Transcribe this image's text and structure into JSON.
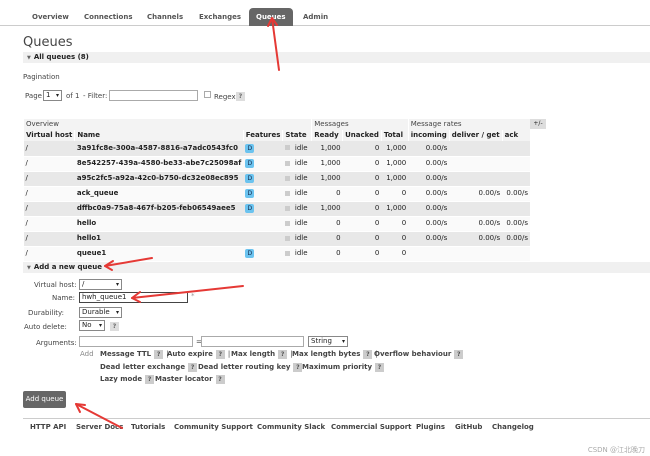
{
  "nav": [
    "Overview",
    "Connections",
    "Channels",
    "Exchanges",
    "Queues",
    "Admin"
  ],
  "page_title": "Queues",
  "all_queues_label": "All queues (8)",
  "pagination": {
    "heading": "Pagination",
    "page_label": "Page",
    "page_value": "1",
    "of_label": "of 1",
    "filter_label": "- Filter:",
    "regex_label": "Regex",
    "help": "?"
  },
  "table": {
    "group_overview": "Overview",
    "group_messages": "Messages",
    "group_rates": "Message rates",
    "plus_minus": "+/-",
    "headers": [
      "Virtual host",
      "Name",
      "Features",
      "State",
      "Ready",
      "Unacked",
      "Total",
      "incoming",
      "deliver / get",
      "ack"
    ],
    "rows": [
      {
        "vhost": "/",
        "name": "3a91fc8e-300a-4587-8816-a7adc0543fc0",
        "feat": "D",
        "state": "idle",
        "ready": "1,000",
        "unacked": "0",
        "total": "1,000",
        "incoming": "0.00/s",
        "deliver": "",
        "ack": ""
      },
      {
        "vhost": "/",
        "name": "8e542257-439a-4580-be33-abe7c25098af",
        "feat": "D",
        "state": "idle",
        "ready": "1,000",
        "unacked": "0",
        "total": "1,000",
        "incoming": "0.00/s",
        "deliver": "",
        "ack": ""
      },
      {
        "vhost": "/",
        "name": "a95c2fc5-a92a-42c0-b750-dc32e08ec895",
        "feat": "D",
        "state": "idle",
        "ready": "1,000",
        "unacked": "0",
        "total": "1,000",
        "incoming": "0.00/s",
        "deliver": "",
        "ack": ""
      },
      {
        "vhost": "/",
        "name": "ack_queue",
        "feat": "D",
        "state": "idle",
        "ready": "0",
        "unacked": "0",
        "total": "0",
        "incoming": "0.00/s",
        "deliver": "0.00/s",
        "ack": "0.00/s"
      },
      {
        "vhost": "/",
        "name": "dffbc0a9-75a8-467f-b205-feb06549aee5",
        "feat": "D",
        "state": "idle",
        "ready": "1,000",
        "unacked": "0",
        "total": "1,000",
        "incoming": "0.00/s",
        "deliver": "",
        "ack": ""
      },
      {
        "vhost": "/",
        "name": "hello",
        "feat": "",
        "state": "idle",
        "ready": "0",
        "unacked": "0",
        "total": "0",
        "incoming": "0.00/s",
        "deliver": "0.00/s",
        "ack": "0.00/s"
      },
      {
        "vhost": "/",
        "name": "hello1",
        "feat": "",
        "state": "idle",
        "ready": "0",
        "unacked": "0",
        "total": "0",
        "incoming": "0.00/s",
        "deliver": "0.00/s",
        "ack": "0.00/s"
      },
      {
        "vhost": "/",
        "name": "queue1",
        "feat": "D",
        "state": "idle",
        "ready": "0",
        "unacked": "0",
        "total": "0",
        "incoming": "",
        "deliver": "",
        "ack": ""
      }
    ]
  },
  "add_section": "Add a new queue",
  "form": {
    "vhost_label": "Virtual host:",
    "vhost_value": "/",
    "name_label": "Name:",
    "name_value": "hwh_queue1",
    "name_star": "*",
    "durability_label": "Durability:",
    "durability_value": "Durable",
    "autodelete_label": "Auto delete:",
    "autodelete_value": "No",
    "help": "?",
    "arguments_label": "Arguments:",
    "equals": "=",
    "type_value": "String",
    "add_label": "Add",
    "arg_links": [
      "Message TTL",
      "Auto expire",
      "Max length",
      "Max length bytes",
      "Overflow behaviour",
      "Dead letter exchange",
      "Dead letter routing key",
      "Maximum priority",
      "Lazy mode",
      "Master locator"
    ],
    "separator": "|",
    "submit": "Add queue"
  },
  "footer": [
    "HTTP API",
    "Server Docs",
    "Tutorials",
    "Community Support",
    "Community Slack",
    "Commercial Support",
    "Plugins",
    "GitHub",
    "Changelog"
  ],
  "watermark": "CSDN @江北晚刀",
  "colors": {
    "accent": "#666666",
    "annotation_arrow": "#e53935",
    "feature_badge": "#6bc3ef"
  },
  "icons": {
    "section_toggle": "triangle-down-icon",
    "dropdown": "chevron-down-icon"
  }
}
